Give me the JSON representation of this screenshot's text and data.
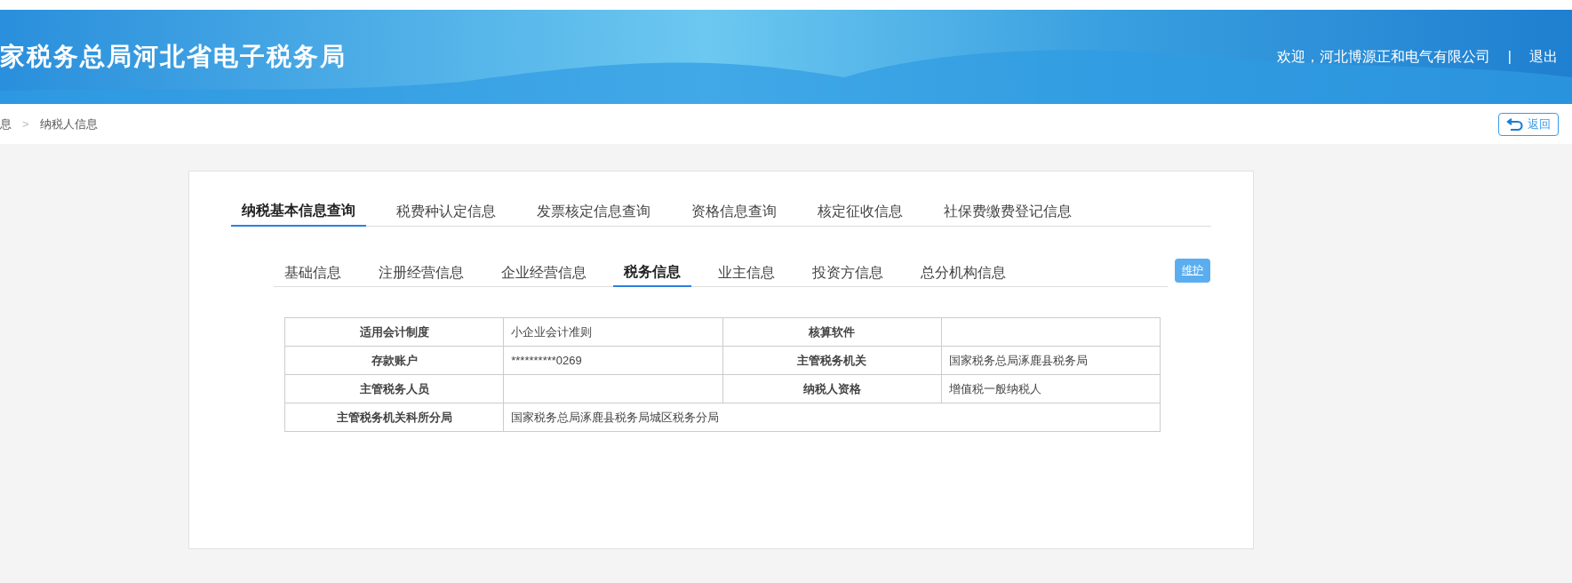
{
  "header": {
    "title": "家税务总局河北省电子税务局",
    "welcome": "欢迎，河北博源正和电气有限公司",
    "separator": "|",
    "logout": "退出"
  },
  "breadcrumb": {
    "items": [
      "息",
      "纳税人信息"
    ],
    "separator": ">"
  },
  "back_button": {
    "label": "返回"
  },
  "main_tabs": [
    {
      "label": "纳税基本信息查询",
      "selected": true
    },
    {
      "label": "税费种认定信息",
      "selected": false
    },
    {
      "label": "发票核定信息查询",
      "selected": false
    },
    {
      "label": "资格信息查询",
      "selected": false
    },
    {
      "label": "核定征收信息",
      "selected": false
    },
    {
      "label": "社保费缴费登记信息",
      "selected": false
    }
  ],
  "sub_tabs": [
    {
      "label": "基础信息",
      "selected": false
    },
    {
      "label": "注册经营信息",
      "selected": false
    },
    {
      "label": "企业经营信息",
      "selected": false
    },
    {
      "label": "税务信息",
      "selected": true
    },
    {
      "label": "业主信息",
      "selected": false
    },
    {
      "label": "投资方信息",
      "selected": false
    },
    {
      "label": "总分机构信息",
      "selected": false
    }
  ],
  "maintain_button": {
    "label": "维护"
  },
  "table": {
    "rows": [
      {
        "cells": [
          {
            "label": "适用会计制度",
            "value": "小企业会计准则"
          },
          {
            "label": "核算软件"
          }
        ]
      },
      {
        "cells": [
          {
            "label": "存款账户",
            "value": "**********0269"
          },
          {
            "label": "主管税务机关",
            "value": "国家税务总局涿鹿县税务局"
          }
        ]
      },
      {
        "cells": [
          {
            "label": "主管税务人员"
          },
          {
            "label": "纳税人资格",
            "value": "增值税一般纳税人"
          }
        ]
      },
      {
        "cells": [
          {
            "label": "主管税务机关科所分局",
            "value": "国家税务总局涿鹿县税务局城区税务分局"
          }
        ]
      }
    ]
  }
}
